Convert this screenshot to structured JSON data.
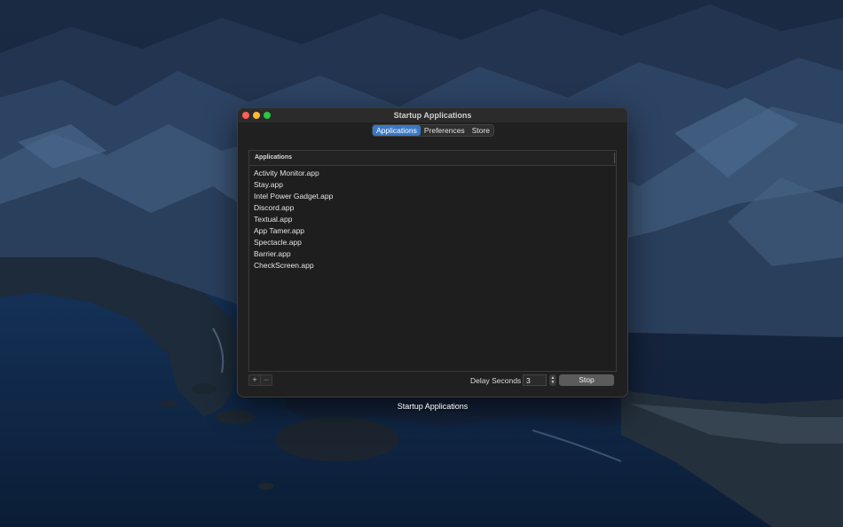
{
  "window": {
    "title": "Startup Applications",
    "tabs": [
      {
        "label": "Applications",
        "active": true
      },
      {
        "label": "Preferences",
        "active": false
      },
      {
        "label": "Store",
        "active": false
      }
    ]
  },
  "table": {
    "header": "Applications",
    "rows": [
      "Activity Monitor.app",
      "Stay.app",
      "Intel Power Gadget.app",
      "Discord.app",
      "Textual.app",
      "App Tamer.app",
      "Spectacle.app",
      "Barrier.app",
      "CheckScreen.app"
    ]
  },
  "footer": {
    "add_label": "+",
    "remove_label": "−",
    "delay_label": "Delay Seconds",
    "delay_value": "3",
    "stop_label": "Stop"
  },
  "desktop": {
    "caption": "Startup Applications"
  },
  "colors": {
    "accent": "#3a79c8",
    "window_bg": "#202020",
    "close": "#fe5f57",
    "minimize": "#febc2e",
    "maximize": "#28c840"
  },
  "icons": {
    "stepper": "up-down-chevron-icon"
  }
}
